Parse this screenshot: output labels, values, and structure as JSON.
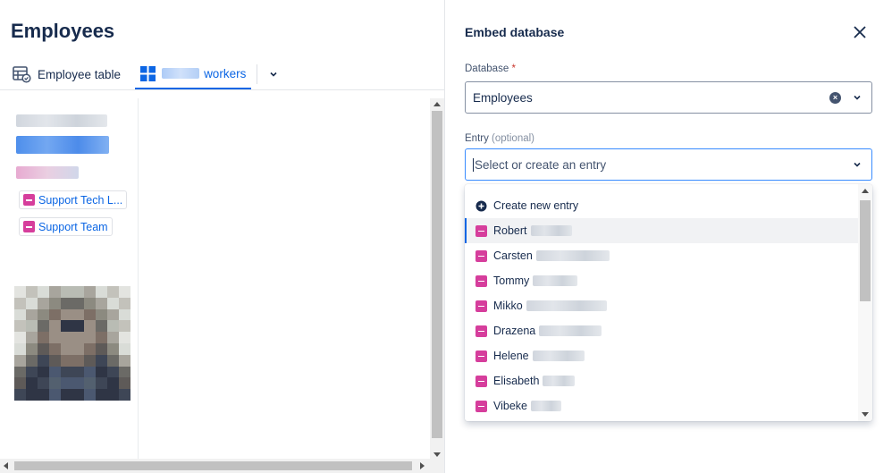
{
  "left": {
    "title": "Employees",
    "tabs": [
      {
        "label": "Employee table"
      },
      {
        "label": "workers"
      }
    ],
    "tags": [
      "Support Tech L...",
      "Support Team"
    ]
  },
  "right": {
    "title": "Embed database",
    "database": {
      "label": "Database",
      "required_mark": "*",
      "value": "Employees"
    },
    "entry": {
      "label": "Entry",
      "optional_text": "(optional)",
      "placeholder": "Select or create an entry"
    },
    "menu": {
      "create_label": "Create new entry",
      "items": [
        "Robert",
        "Carsten",
        "Tommy",
        "Mikko",
        "Drazena",
        "Helene",
        "Elisabeth",
        "Vibeke"
      ]
    }
  },
  "colors": {
    "accent": "#0c66e4",
    "entry_icon": "#d63e9c",
    "focus_border": "#388bff"
  }
}
